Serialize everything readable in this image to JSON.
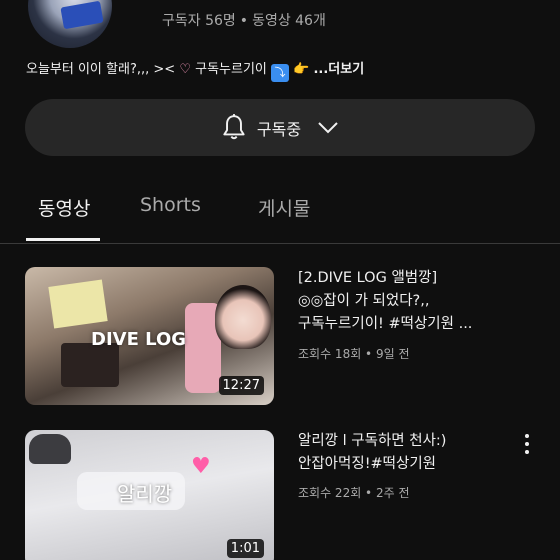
{
  "channel": {
    "stats": {
      "subscribers": "구독자 56명",
      "separator": "•",
      "videos": "동영상 46개"
    },
    "description": {
      "part1": "오늘부터 이이 할래?,,, ><",
      "heart": "♡",
      "part2": "구독누르기이",
      "box_emoji": "⤵",
      "hand_emoji": "👉",
      "more": "...더보기"
    }
  },
  "subscribe_button": {
    "label": "구독중",
    "icon": "bell-icon",
    "dropdown_icon": "chevron-down-icon"
  },
  "tabs": [
    {
      "label": "동영상",
      "active": true
    },
    {
      "label": "Shorts",
      "active": false
    },
    {
      "label": "게시물",
      "active": false
    }
  ],
  "videos": [
    {
      "title": "[2.DIVE LOG 앨범깡] ◎◎잡이 가 되었다?,, 구독누르기이! #떡상기원 ...",
      "title_lines": [
        "[2.DIVE LOG 앨범깡]",
        "◎◎잡이 가 되었다?,,",
        "구독누르기이! #떡상기원 ..."
      ],
      "meta": "조회수 18회 • 9일 전",
      "duration": "12:27",
      "thumb_text": "DIVE LOG"
    },
    {
      "title": "알리깡 l 구독하면 천사:) 안잡아먹징!#떡상기원",
      "title_lines": [
        "알리깡 l 구독하면 천사:)",
        "안잡아먹징!#떡상기원"
      ],
      "meta": "조회수 22회 • 2주 전",
      "duration": "1:01",
      "thumb_text": "알리깡"
    }
  ]
}
